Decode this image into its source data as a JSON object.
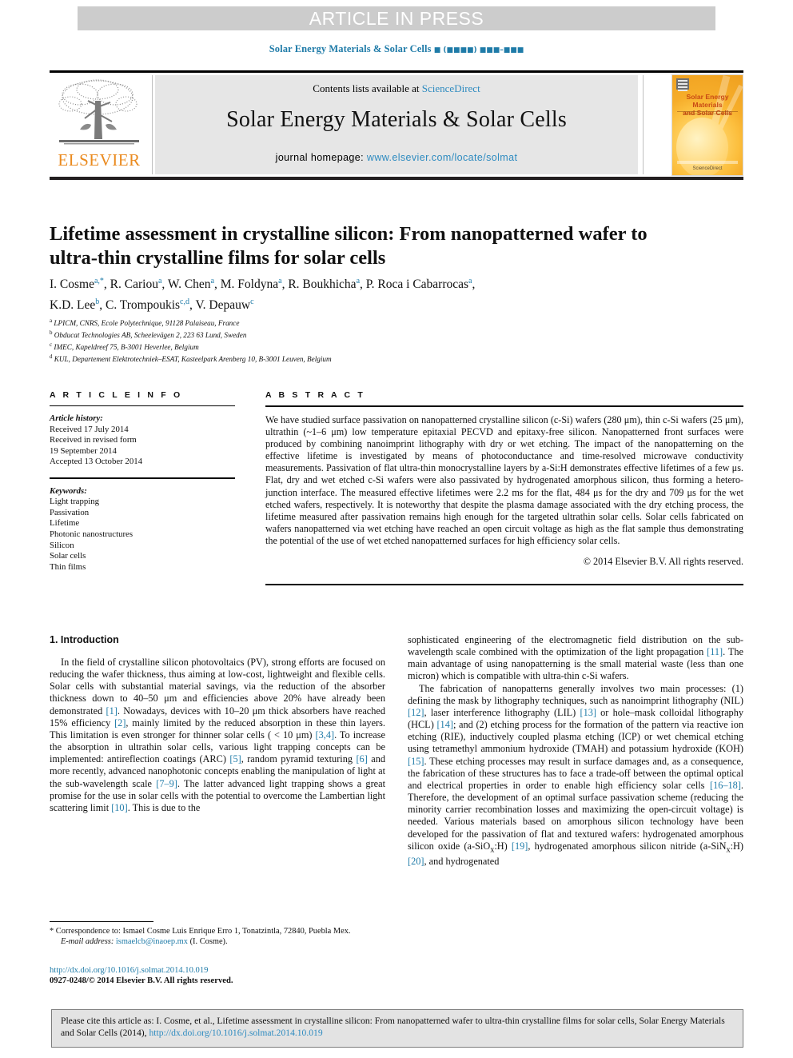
{
  "banner": {
    "text": "ARTICLE IN PRESS"
  },
  "running_head": {
    "journal": "Solar Energy Materials & Solar Cells",
    "volume_placeholder": "■ (■■■■) ■■■–■■■"
  },
  "masthead": {
    "publisher": "ELSEVIER",
    "contents_prefix": "Contents lists available at",
    "contents_link": "ScienceDirect",
    "journal_title": "Solar Energy Materials & Solar Cells",
    "homepage_prefix": "journal homepage:",
    "homepage_url": "www.elsevier.com/locate/solmat",
    "cover": {
      "title_line1": "Solar Energy Materials",
      "title_line2": "and Solar Cells",
      "footer": "ScienceDirect"
    }
  },
  "article": {
    "title": "Lifetime assessment in crystalline silicon: From nanopatterned wafer to ultra-thin crystalline films for solar cells",
    "authors_line1": "I. Cosme<sup>a,*</sup>, R. Cariou<sup>a</sup>, W. Chen<sup>a</sup>, M. Foldyna<sup>a</sup>, R. Boukhicha<sup>a</sup>, P. Roca i Cabarrocas<sup>a</sup>,",
    "authors_line2": "K.D. Lee<sup>b</sup>, C. Trompoukis<sup>c,d</sup>, V. Depauw<sup>c</sup>",
    "affiliations": [
      "<sup>a</sup> LPICM, CNRS, Ecole Polytechnique, 91128 Palaiseau, France",
      "<sup>b</sup> Obducat Technologies AB, Scheelevägen 2, 223 63 Lund, Sweden",
      "<sup>c</sup> IMEC, Kapeldreef 75, B-3001 Heverlee, Belgium",
      "<sup>d</sup> KUL, Departement Elektrotechniek–ESAT, Kasteelpark Arenberg 10, B-3001 Leuven, Belgium"
    ]
  },
  "article_info": {
    "heading": "A R T I C L E  I N F O",
    "history_label": "Article history:",
    "history": [
      "Received 17 July 2014",
      "Received in revised form",
      "19 September 2014",
      "Accepted 13 October 2014"
    ],
    "keywords_label": "Keywords:",
    "keywords": [
      "Light trapping",
      "Passivation",
      "Lifetime",
      "Photonic nanostructures",
      "Silicon",
      "Solar cells",
      "Thin films"
    ]
  },
  "abstract": {
    "heading": "A B S T R A C T",
    "body": "We have studied surface passivation on nanopatterned crystalline silicon (c-Si) wafers (280 μm), thin c-Si wafers (25 μm), ultrathin (~1–6 μm) low temperature epitaxial PECVD and epitaxy-free silicon. Nanopatterned front surfaces were produced by combining nanoimprint lithography with dry or wet etching. The impact of the nanopatterning on the effective lifetime is investigated by means of photoconductance and time-resolved microwave conductivity measurements. Passivation of flat ultra-thin monocrystalline layers by a-Si:H demonstrates effective lifetimes of a few μs. Flat, dry and wet etched c-Si wafers were also passivated by hydrogenated amorphous silicon, thus forming a hetero-junction interface. The measured effective lifetimes were 2.2 ms for the flat, 484 μs for the dry and 709 μs for the wet etched wafers, respectively. It is noteworthy that despite the plasma damage associated with the dry etching process, the lifetime measured after passivation remains high enough for the targeted ultrathin solar cells. Solar cells fabricated on wafers nanopatterned via wet etching have reached an open circuit voltage as high as the flat sample thus demonstrating the potential of the use of wet etched nanopatterned surfaces for high efficiency solar cells.",
    "copyright": "© 2014 Elsevier B.V. All rights reserved."
  },
  "body": {
    "section_heading": "1. Introduction",
    "left_paragraphs": [
      "In the field of crystalline silicon photovoltaics (PV), strong efforts are focused on reducing the wafer thickness, thus aiming at low-cost, lightweight and flexible cells. Solar cells with substantial material savings, via the reduction of the absorber thickness down to 40–50 μm and efficiencies above 20% have already been demonstrated <span class=\"ref\">[1]</span>. Nowadays, devices with 10–20 μm thick absorbers have reached 15% efficiency <span class=\"ref\">[2]</span>, mainly limited by the reduced absorption in these thin layers. This limitation is even stronger for thinner solar cells ( &lt; 10 μm) <span class=\"ref\">[3,4]</span>. To increase the absorption in ultrathin solar cells, various light trapping concepts can be implemented: antireflection coatings (ARC) <span class=\"ref\">[5]</span>, random pyramid texturing <span class=\"ref\">[6]</span> and more recently, advanced nanophotonic concepts enabling the manipulation of light at the sub-wavelength scale <span class=\"ref\">[7–9]</span>. The latter advanced light trapping shows a great promise for the use in solar cells with the potential to overcome the Lambertian light scattering limit <span class=\"ref\">[10]</span>. This is due to the"
    ],
    "right_paragraphs": [
      "sophisticated engineering of the electromagnetic field distribution on the sub-wavelength scale combined with the optimization of the light propagation <span class=\"ref\">[11]</span>. The main advantage of using nanopatterning is the small material waste (less than one micron) which is compatible with ultra-thin c-Si wafers.",
      "The fabrication of nanopatterns generally involves two main processes: (1) defining the mask by lithography techniques, such as nanoimprint lithography (NIL) <span class=\"ref\">[12]</span>, laser interference lithography (LIL) <span class=\"ref\">[13]</span> or hole–mask colloidal lithography (HCL) <span class=\"ref\">[14]</span>; and (2) etching process for the formation of the pattern via reactive ion etching (RIE), inductively coupled plasma etching (ICP) or wet chemical etching using tetramethyl ammonium hydroxide (TMAH) and potassium hydroxide (KOH) <span class=\"ref\">[15]</span>. These etching processes may result in surface damages and, as a consequence, the fabrication of these structures has to face a trade-off between the optimal optical and electrical properties in order to enable high efficiency solar cells <span class=\"ref\">[16–18]</span>. Therefore, the development of an optimal surface passivation scheme (reducing the minority carrier recombination losses and maximizing the open-circuit voltage) is needed. Various materials based on amorphous silicon technology have been developed for the passivation of flat and textured wafers: hydrogenated amorphous silicon oxide (a-SiO<sub>x</sub>:H) <span class=\"ref\">[19]</span>, hydrogenated amorphous silicon nitride (a-SiN<sub>x</sub>:H) <span class=\"ref\">[20]</span>, and hydrogenated"
    ]
  },
  "footnote": {
    "correspondence": "* Correspondence to: Ismael Cosme Luis Enrique Erro 1, Tonatzintla, 72840, Puebla Mex.",
    "email_label": "E-mail address:",
    "email": "ismaelcb@inaoep.mx",
    "email_owner": "(I. Cosme)."
  },
  "imprint": {
    "doi": "http://dx.doi.org/10.1016/j.solmat.2014.10.019",
    "issn_line": "0927-0248/© 2014 Elsevier B.V. All rights reserved."
  },
  "cite_box": {
    "text": "Please cite this article as: I. Cosme, et al., Lifetime assessment in crystalline silicon: From nanopatterned wafer to ultra-thin crystalline films for solar cells, Solar Energy Materials and Solar Cells (2014),",
    "link": "http://dx.doi.org/10.1016/j.solmat.2014.10.019"
  },
  "colors": {
    "link_blue": "#2e8bc0",
    "ref_blue": "#1f7ba8",
    "elsevier_orange": "#ea8a1e",
    "banner_grey": "#cccccc",
    "panel_grey": "#e6e6e6"
  }
}
